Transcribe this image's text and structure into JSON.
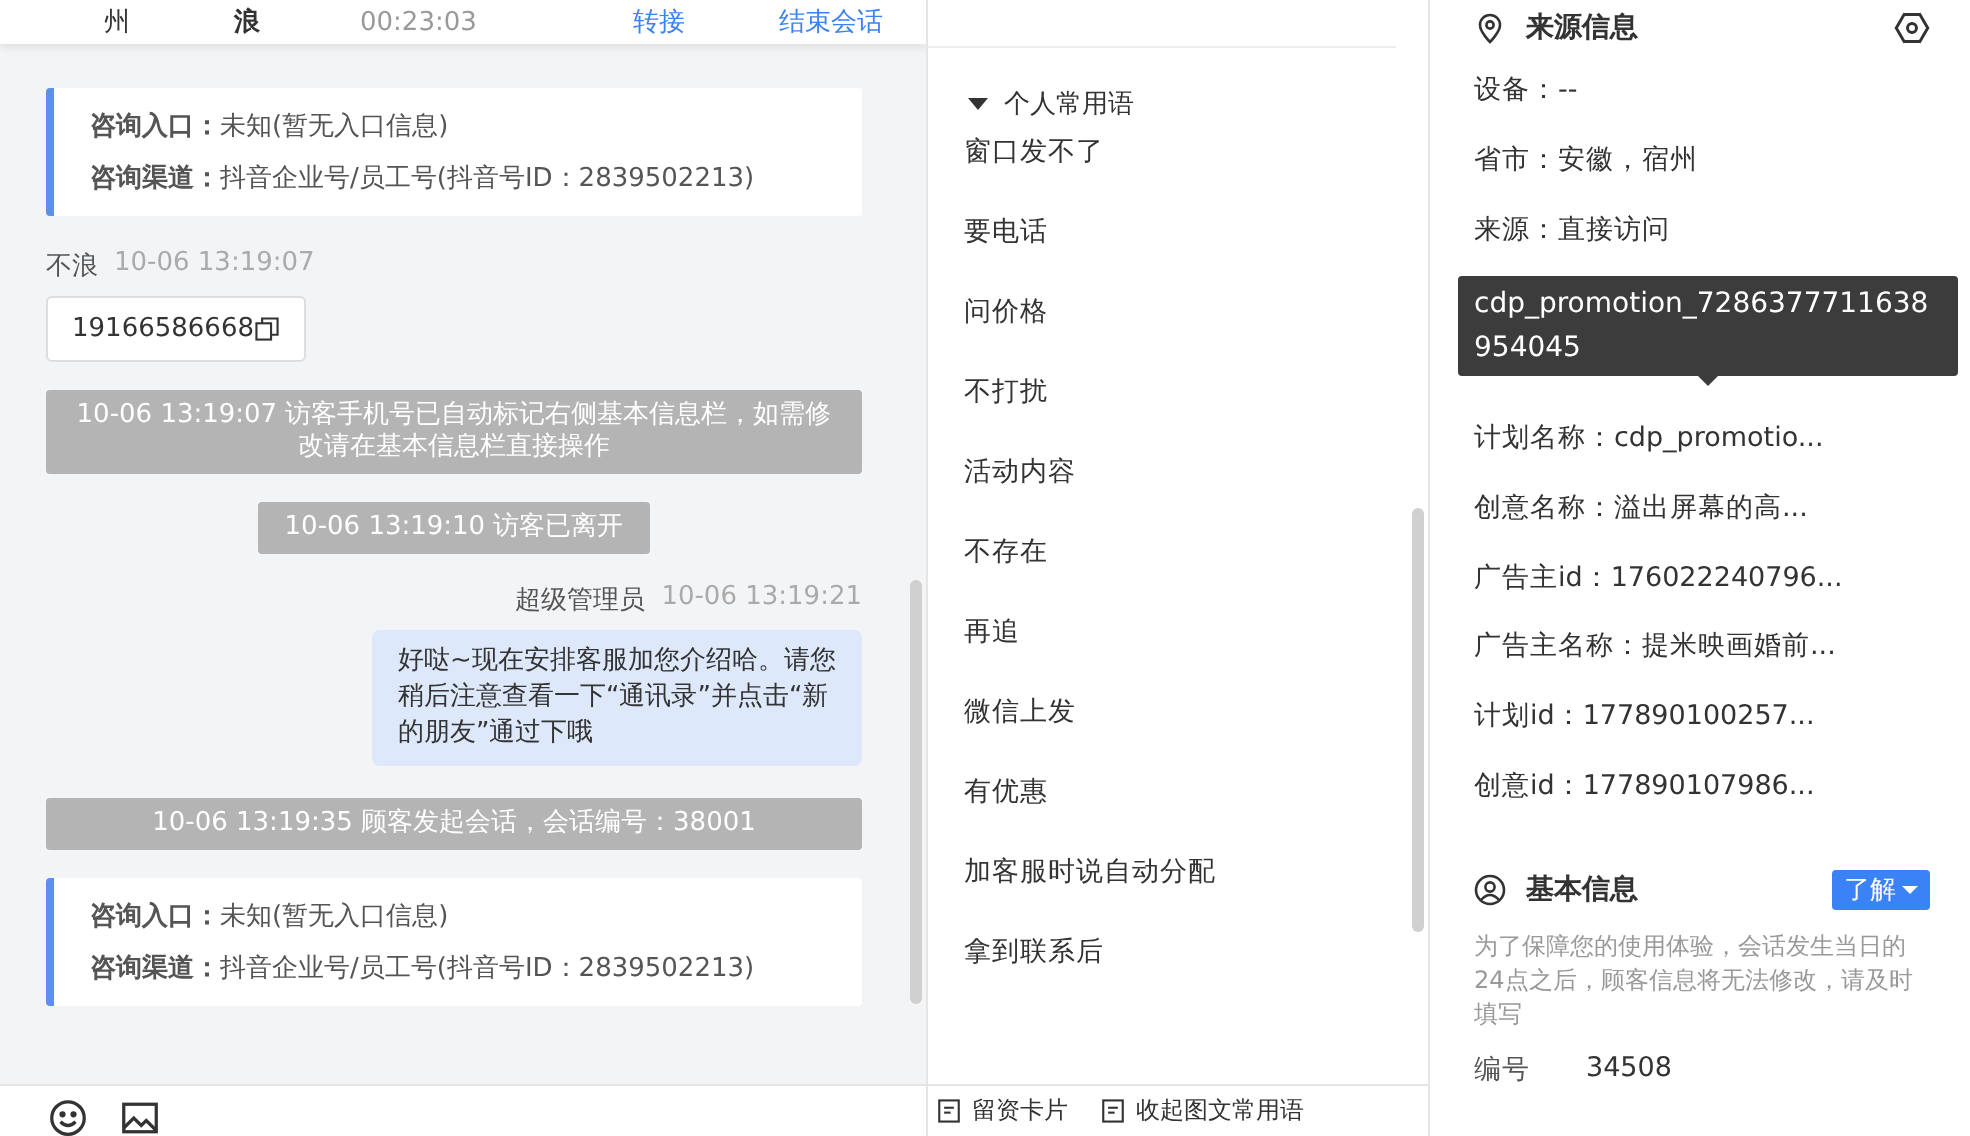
{
  "chat_header": {
    "location": "州",
    "visitor": "浪",
    "duration": "00:23:03",
    "actions": [
      "转接",
      "结束会话"
    ]
  },
  "messages": [
    {
      "kind": "info_card",
      "rows": [
        {
          "label": "咨询入口：",
          "value": "未知(暂无入口信息)"
        },
        {
          "label": "咨询渠道：",
          "value": "抖音企业号/员工号(抖音号ID：2839502213)"
        }
      ]
    },
    {
      "kind": "visitor_sender",
      "name": "不浪",
      "time": "10-06 13:19:07"
    },
    {
      "kind": "phone",
      "text": "19166586668"
    },
    {
      "kind": "system",
      "text": "10-06 13:19:07 访客手机号已自动标记右侧基本信息栏，如需修改请在基本信息栏直接操作"
    },
    {
      "kind": "system",
      "text": "10-06 13:19:10 访客已离开"
    },
    {
      "kind": "agent_sender",
      "name": "超级管理员",
      "time": "10-06 13:19:21"
    },
    {
      "kind": "agent_bubble",
      "text": "好哒~现在安排客服加您介绍哈。请您稍后注意查看一下“通讯录”并点击“新的朋友”通过下哦"
    },
    {
      "kind": "system",
      "text": "10-06 13:19:35 顾客发起会话，会话编号：38001"
    },
    {
      "kind": "info_card",
      "rows": [
        {
          "label": "咨询入口：",
          "value": "未知(暂无入口信息)"
        },
        {
          "label": "咨询渠道：",
          "value": "抖音企业号/员工号(抖音号ID：2839502213)"
        }
      ]
    }
  ],
  "phrases": {
    "group": {
      "title": "个人常用语",
      "expanded": true
    },
    "items": [
      "窗口发不了",
      "要电话",
      "问价格",
      "不打扰",
      "活动内容",
      "不存在",
      "再追",
      "微信上发",
      "有优惠",
      "加客服时说自动分配",
      "拿到联系后"
    ]
  },
  "phrase_toolbar": [
    "留资卡片",
    "收起图文常用语"
  ],
  "source_info": {
    "title": "来源信息",
    "rows_before_tooltip": [
      "设备：--",
      "省市：安徽，宿州",
      "来源：直接访问"
    ],
    "tooltip": "cdp_promotion_7286377711638954045",
    "rows_after_tooltip": [
      "计划名称：cdp_promotio...",
      "创意名称：溢出屏幕的高...",
      "广告主id：176022240796...",
      "广告主名称：提米映画婚前...",
      "计划id：177890100257...",
      "创意id：177890107986..."
    ]
  },
  "basic_info": {
    "title": "基本信息",
    "button": "了解",
    "note": "为了保障您的使用体验，会话发生当日的24点之后，顾客信息将无法修改，请及时填写",
    "fields": [
      {
        "label": "编号",
        "value": "34508"
      }
    ]
  }
}
